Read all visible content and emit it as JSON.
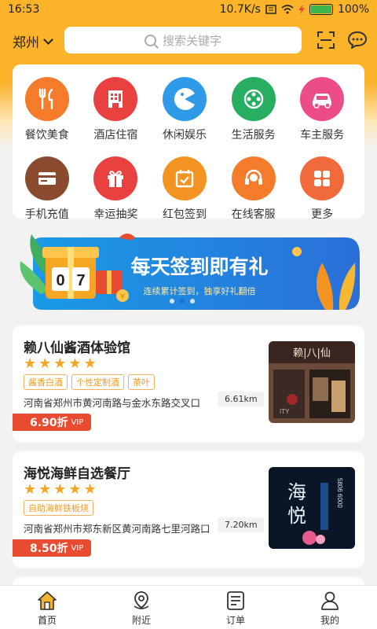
{
  "status": {
    "time": "16:53",
    "speed": "10.7K/s",
    "battery": "100%"
  },
  "header": {
    "city": "郑州",
    "search_placeholder": "搜索关键字"
  },
  "categories": [
    {
      "label": "餐饮美食",
      "color": "#f47b2a",
      "icon": "utensils-icon"
    },
    {
      "label": "酒店住宿",
      "color": "#e94040",
      "icon": "hotel-icon"
    },
    {
      "label": "休闲娱乐",
      "color": "#2e9ae8",
      "icon": "pacman-icon"
    },
    {
      "label": "生活服务",
      "color": "#27ae60",
      "icon": "film-reel-icon"
    },
    {
      "label": "车主服务",
      "color": "#ec4d86",
      "icon": "car-service-icon"
    },
    {
      "label": "手机充值",
      "color": "#8a4a2e",
      "icon": "card-icon"
    },
    {
      "label": "幸运抽奖",
      "color": "#e94040",
      "icon": "gift-icon"
    },
    {
      "label": "红包签到",
      "color": "#f39422",
      "icon": "calendar-check-icon"
    },
    {
      "label": "在线客服",
      "color": "#f47b2a",
      "icon": "headset-icon"
    },
    {
      "label": "更多",
      "color": "#f06a3c",
      "icon": "grid-icon"
    }
  ],
  "banner": {
    "title": "每天签到即有礼",
    "subtitle": "连续累计签到，独享好礼翻倍",
    "digits": [
      "0",
      "7"
    ],
    "coin": "¥"
  },
  "shops": [
    {
      "name": "赖八仙酱酒体验馆",
      "tags": [
        "酱香白酒",
        "个性定制酒",
        "茶叶"
      ],
      "address": "河南省郑州市黄河南路与金水东路交叉口",
      "distance": "6.61km",
      "discount": "6.90折",
      "vip": "VIP",
      "sign_text": "赖|八|仙",
      "sign_text2": "ITY"
    },
    {
      "name": "海悦海鲜自选餐厅",
      "tags": [
        "自助海鲜铁板烧"
      ],
      "address": "河南省郑州市郑东新区黄河南路七里河路口",
      "distance": "7.20km",
      "discount": "8.50折",
      "vip": "VIP",
      "sign_text": "海",
      "sign_text2": "悦",
      "sign_phone": "5806 6000"
    }
  ],
  "nav": [
    {
      "label": "首页",
      "icon": "home-icon"
    },
    {
      "label": "附近",
      "icon": "location-pin-icon"
    },
    {
      "label": "订单",
      "icon": "order-list-icon"
    },
    {
      "label": "我的",
      "icon": "user-icon"
    }
  ]
}
